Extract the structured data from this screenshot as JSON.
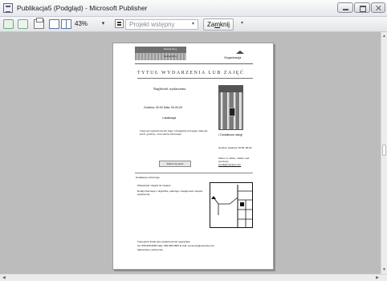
{
  "window": {
    "title": "Publikacja5 (Podgląd) - Microsoft Publisher",
    "icon": "publisher-icon"
  },
  "toolbar": {
    "zoom": "43%",
    "template_select": "Projekt wstępny",
    "close_label_prefix": "Za",
    "close_label_accel": "m",
    "close_label_suffix": "knij",
    "more_glyph": "▾"
  },
  "glyphs": {
    "dropdown": "▾",
    "scroll_up": "▲",
    "scroll_down": "▼",
    "scroll_left": "◀",
    "scroll_right": "▶"
  },
  "publication": {
    "header_top": "Nazwa firmy",
    "header_bottom": "Nazwa firmy",
    "org_name": "Organizacja",
    "event_title": "TYTUŁ WYDARZENIA LUB ZAJĘĆ",
    "subtitle": "Nagłówek wydarzenia",
    "datetime": "Godzina: 00:00   Data: 00-00-00",
    "location": "Lokalizacja",
    "description": "Tutaj opis wydarzenia lub zajęć. Uwzględnij szczegóły, takie jak koszt, godziny, i inne ważne informacje.",
    "bullet": "Dodatkowe usługi",
    "contact_hours": "Godziny otwarcia: 00:00–00:00",
    "contact_address": "Adres: ul. Adres, miasto, kod pocztowy",
    "contact_email": "email@example.com",
    "signup_button": "Zapisz się teraz",
    "section_label": "Dodatkowe informacje",
    "map_heading": "Wskazówki i dojazd do miejsca",
    "map_description": "Dodaj informacje o dojeździe, parkingu i dostępności miejsca wydarzenia.",
    "footer_line1": "Tutaj wpisz krótki opis wydarzenia lub organizacji.",
    "footer_line2": "Tel: 555-555-5555  Faks: 555-555-5555  E-mail: someone@example.com",
    "footer_line3": "Zapraszamy serdecznie"
  }
}
